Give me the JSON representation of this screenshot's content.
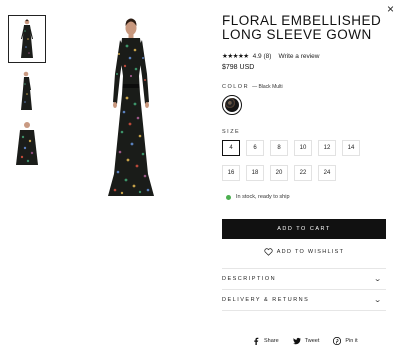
{
  "close": {
    "glyph": "×"
  },
  "product": {
    "title": "FLORAL EMBELLISHED LONG SLEEVE GOWN",
    "stars": "★★★★★",
    "rating": "4.9 (8)",
    "review_link": "Write a review",
    "price": "$798 USD"
  },
  "color": {
    "label": "COLOR",
    "selected": "— Black Multi"
  },
  "size": {
    "label": "SIZE",
    "options": [
      "4",
      "6",
      "8",
      "10",
      "12",
      "14",
      "16",
      "18",
      "20",
      "22",
      "24"
    ],
    "selected": "4"
  },
  "stock": {
    "text": "In stock, ready to ship",
    "color": "#4caf50"
  },
  "actions": {
    "add_to_cart": "ADD TO CART",
    "wishlist": "ADD TO WISHLIST"
  },
  "accordion": {
    "description": "DESCRIPTION",
    "delivery": "DELIVERY & RETURNS"
  },
  "share": {
    "share": "Share",
    "tweet": "Tweet",
    "pin": "Pin it"
  }
}
